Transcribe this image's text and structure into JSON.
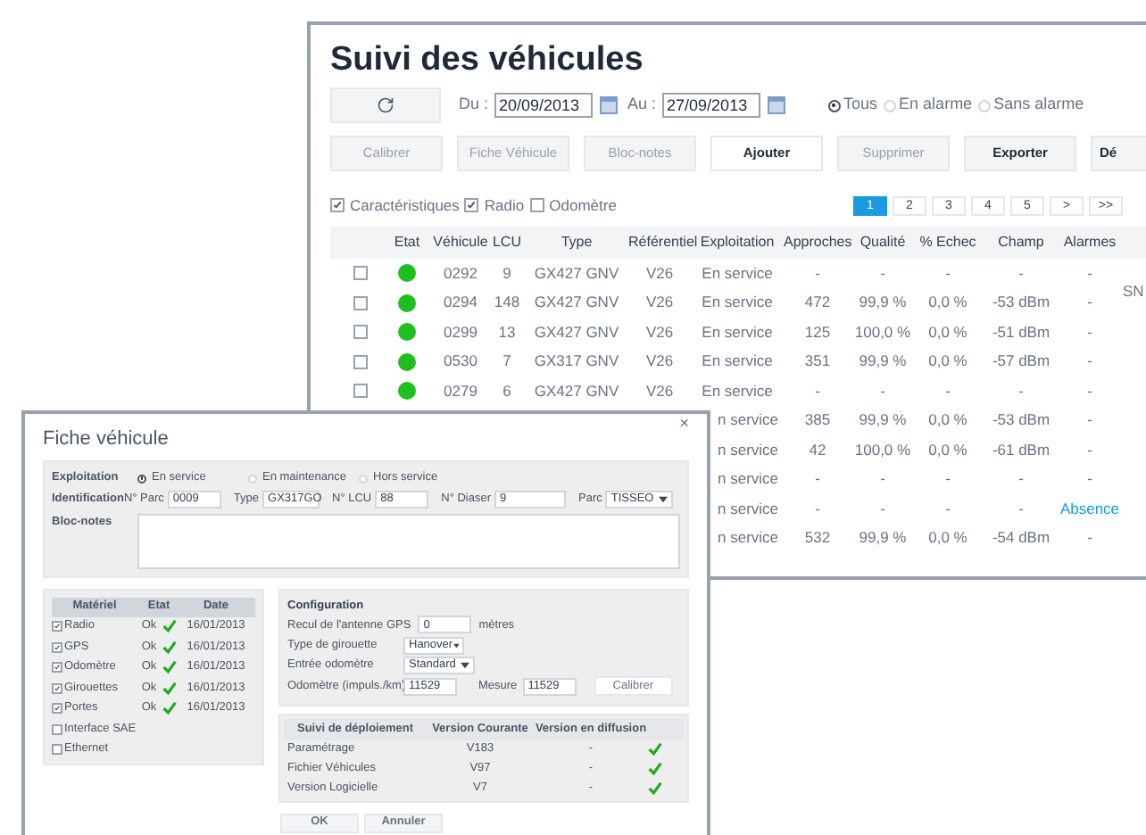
{
  "main_window": {
    "title": "Suivi des véhicules",
    "date_from": {
      "label": "Du :",
      "value": "20/09/2013"
    },
    "date_to": {
      "label": "Au :",
      "value": "27/09/2013"
    },
    "filter_radios": [
      {
        "label": "Tous",
        "selected": true
      },
      {
        "label": "En alarme",
        "selected": false
      },
      {
        "label": "Sans alarme",
        "selected": false
      }
    ],
    "buttons": [
      {
        "label": "Calibrer",
        "disabled": true,
        "highlighted": false
      },
      {
        "label": "Fiche Véhicule",
        "disabled": true,
        "highlighted": false
      },
      {
        "label": "Bloc-notes",
        "disabled": true,
        "highlighted": false
      },
      {
        "label": "Ajouter",
        "disabled": false,
        "highlighted": true
      },
      {
        "label": "Supprimer",
        "disabled": true,
        "highlighted": false
      },
      {
        "label": "Exporter",
        "disabled": false,
        "highlighted": false
      },
      {
        "label": "Dé",
        "disabled": false,
        "highlighted": false
      }
    ],
    "column_options": [
      {
        "label": "Caractéristiques",
        "checked": true
      },
      {
        "label": "Radio",
        "checked": true
      },
      {
        "label": "Odomètre",
        "checked": false
      }
    ],
    "pagination": [
      {
        "label": "1",
        "selected": true
      },
      {
        "label": "2",
        "selected": false
      },
      {
        "label": "3",
        "selected": false
      },
      {
        "label": "4",
        "selected": false
      },
      {
        "label": "5",
        "selected": false
      },
      {
        "label": ">",
        "selected": false
      },
      {
        "label": ">>",
        "selected": false
      }
    ],
    "table": {
      "status_column": "Etat",
      "columns": [
        "Véhicule",
        "LCU",
        "Type",
        "Référentiel",
        "Exploitation",
        "Approches",
        "Qualité",
        "% Echec",
        "Champ",
        "Alarmes"
      ],
      "rows": [
        {
          "checked": false,
          "color": "#1fbf1f",
          "alarm": false,
          "cells": [
            "0292",
            "9",
            "GX427 GNV",
            "V26",
            "En service",
            "-",
            "-",
            "-",
            "-",
            "-"
          ]
        },
        {
          "checked": false,
          "color": "#1fbf1f",
          "alarm": false,
          "cells": [
            "0294",
            "148",
            "GX427 GNV",
            "V26",
            "En service",
            "472",
            "99,9 %",
            "0,0 %",
            "-53 dBm",
            "-"
          ],
          "column_12": "SN"
        },
        {
          "checked": false,
          "color": "#1fbf1f",
          "alarm": false,
          "cells": [
            "0299",
            "13",
            "GX427 GNV",
            "V26",
            "En service",
            "125",
            "100,0 %",
            "0,0 %",
            "-51 dBm",
            "-"
          ]
        },
        {
          "checked": false,
          "color": "#1fbf1f",
          "alarm": false,
          "cells": [
            "0530",
            "7",
            "GX317 GNV",
            "V26",
            "En service",
            "351",
            "99,9 %",
            "0,0 %",
            "-57 dBm",
            "-"
          ]
        },
        {
          "checked": false,
          "color": "#1fbf1f",
          "alarm": false,
          "cells": [
            "0279",
            "6",
            "GX427 GNV",
            "V26",
            "En service",
            "-",
            "-",
            "-",
            "-",
            "-"
          ]
        },
        {
          "alarm": false,
          "cells": [
            "n service",
            "385",
            "99,9 %",
            "0,0 %",
            "-53 dBm",
            "-"
          ]
        },
        {
          "alarm": false,
          "cells": [
            "n service",
            "42",
            "100,0 %",
            "0,0 %",
            "-61 dBm",
            "-"
          ]
        },
        {
          "alarm": false,
          "cells": [
            "n service",
            "-",
            "-",
            "-",
            "-",
            "-"
          ]
        },
        {
          "alarm": true,
          "cells": [
            "n service",
            "-",
            "-",
            "-",
            "-",
            "Absence"
          ]
        },
        {
          "alarm": false,
          "cells": [
            "n service",
            "532",
            "99,9 %",
            "0,0 %",
            "-54 dBm",
            "-"
          ]
        }
      ]
    }
  },
  "dialog": {
    "title": "Fiche véhicule",
    "close": "×",
    "exploitation": {
      "label": "Exploitation",
      "options": [
        {
          "label": "En service",
          "selected": true
        },
        {
          "label": "En maintenance",
          "selected": false
        },
        {
          "label": "Hors service",
          "selected": false
        }
      ]
    },
    "identification": {
      "label": "Identification",
      "fields": [
        {
          "label": "N° Parc",
          "value": "0009",
          "kind": "text"
        },
        {
          "label": "Type",
          "value": "GX317GO",
          "kind": "text"
        },
        {
          "label": "N° LCU",
          "value": "88",
          "kind": "text"
        },
        {
          "label": "N° Diaser",
          "value": "9",
          "kind": "text"
        },
        {
          "label": "Parc",
          "value": "TISSEO",
          "kind": "select"
        }
      ]
    },
    "notes": {
      "label": "Bloc-notes"
    },
    "hardware": {
      "columns": [
        "Matériel",
        "Etat",
        "Date"
      ],
      "items": [
        {
          "label": "Radio",
          "checked": true,
          "status": "Ok",
          "date": "16/01/2013"
        },
        {
          "label": "GPS",
          "checked": true,
          "status": "Ok",
          "date": "16/01/2013"
        },
        {
          "label": "Odomètre",
          "checked": true,
          "status": "Ok",
          "date": "16/01/2013"
        },
        {
          "label": "Girouettes",
          "checked": true,
          "status": "Ok",
          "date": "16/01/2013"
        },
        {
          "label": "Portes",
          "checked": true,
          "status": "Ok",
          "date": "16/01/2013"
        },
        {
          "label": "Interface SAE",
          "checked": false
        },
        {
          "label": "Ethernet",
          "checked": false
        }
      ]
    },
    "configuration": {
      "title": "Configuration",
      "gps_offset": {
        "label": "Recul de l'antenne GPS",
        "value": "0",
        "unit": "mètres"
      },
      "vane_type": {
        "label": "Type de girouette",
        "value": "Hanover"
      },
      "odometer_input": {
        "label": "Entrée odomètre",
        "value": "Standard"
      },
      "odometer": {
        "label": "Odomètre (impuls./km)",
        "value": "11529"
      },
      "measure": {
        "label": "Mesure",
        "value": "11529"
      },
      "calibrate_button": "Calibrer"
    },
    "deployment": {
      "columns": [
        "Suivi de déploiement",
        "Version Courante",
        "Version en diffusion"
      ],
      "rows": [
        {
          "name": "Paramétrage",
          "current": "V183",
          "broadcast": "-",
          "ok": true
        },
        {
          "name": "Fichier Véhicules",
          "current": "V97",
          "broadcast": "-",
          "ok": true
        },
        {
          "name": "Version Logicielle",
          "current": "V7",
          "broadcast": "-",
          "ok": true
        }
      ]
    },
    "buttons": [
      "OK",
      "Annuler"
    ]
  }
}
